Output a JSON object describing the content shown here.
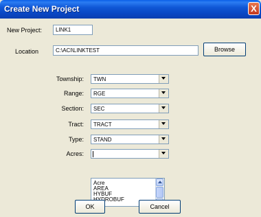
{
  "window": {
    "title": "Create New Project",
    "close_glyph": "X"
  },
  "project": {
    "name_label": "New Project:",
    "name_value": "LINK1",
    "location_label": "Location",
    "location_value": "C:\\ACI\\LINKTEST",
    "browse_label": "Browse"
  },
  "fields": [
    {
      "label": "Township:",
      "value": "TWN"
    },
    {
      "label": "Range:",
      "value": "RGE"
    },
    {
      "label": "Section:",
      "value": "SEC"
    },
    {
      "label": "Tract:",
      "value": "TRACT"
    },
    {
      "label": "Type:",
      "value": "STAND"
    },
    {
      "label": "Acres:",
      "value": ""
    }
  ],
  "acres_options": [
    "Acre",
    "AREA",
    "HYBUF",
    "HYDROBUF"
  ],
  "buttons": {
    "ok": "OK",
    "cancel": "Cancel"
  },
  "icons": [
    "close-icon",
    "dropdown-arrow-icon",
    "scroll-up-icon",
    "scroll-down-icon"
  ]
}
